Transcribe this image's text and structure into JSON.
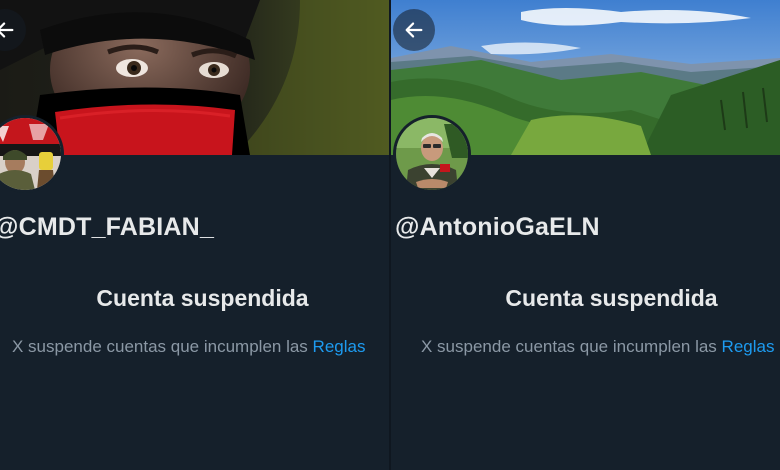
{
  "profiles": [
    {
      "handle": "@CMDT_FABIAN_",
      "status_title": "Cuenta suspendida",
      "status_text": "X suspende cuentas que incumplen las",
      "rules_link": "Reglas"
    },
    {
      "handle": "@AntonioGaELN",
      "status_title": "Cuenta suspendida",
      "status_text": "X suspende cuentas que incumplen las",
      "rules_link": "Reglas"
    }
  ],
  "icons": {
    "back": "arrow-left-icon"
  },
  "colors": {
    "background": "#15202b",
    "primary_text": "#e7e9ea",
    "secondary_text": "#8b98a5",
    "link": "#1d9bf0"
  }
}
